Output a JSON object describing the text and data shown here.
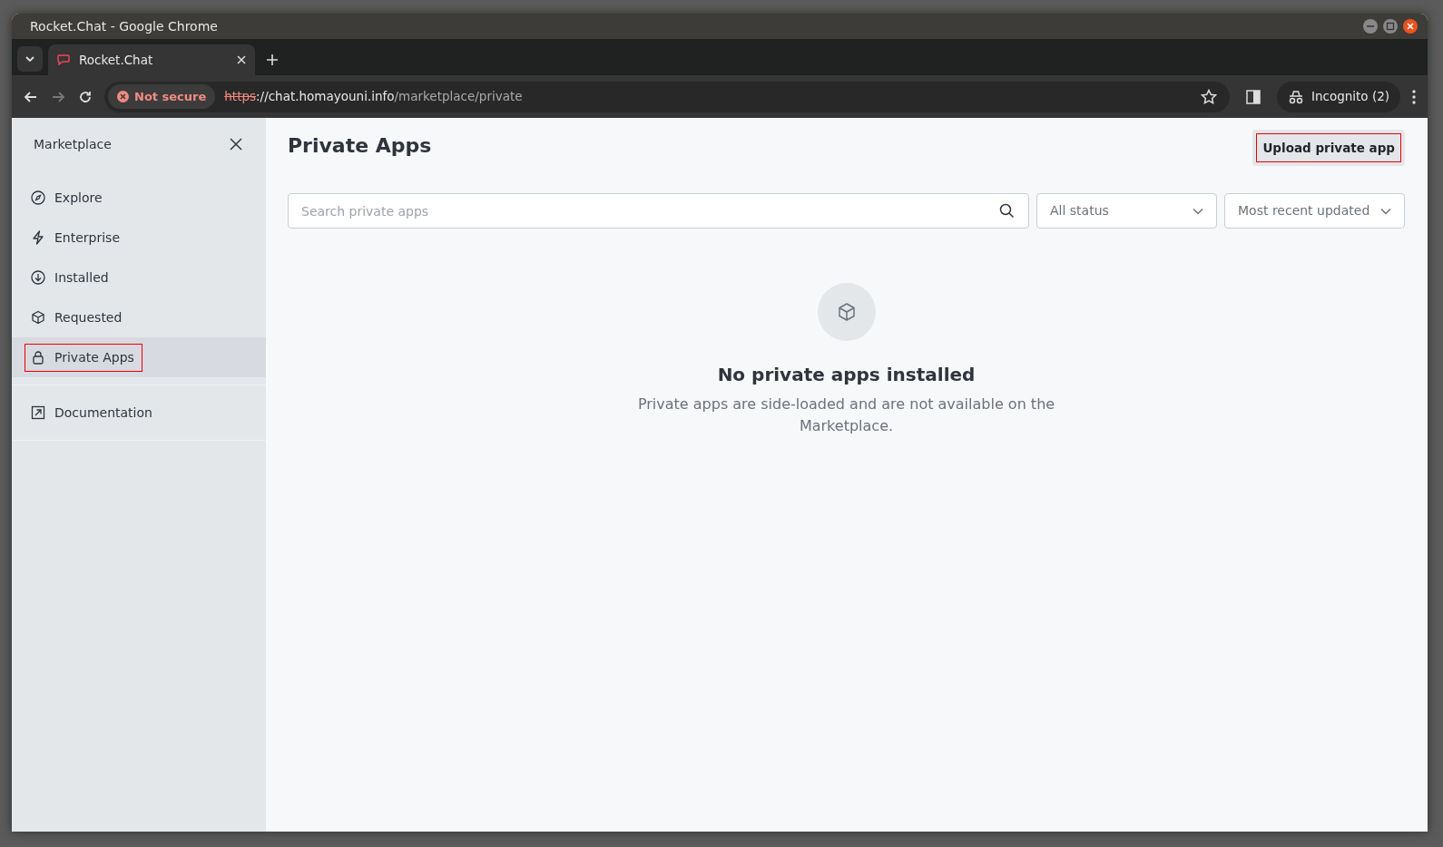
{
  "window": {
    "title": "Rocket.Chat - Google Chrome"
  },
  "browser": {
    "tabs": [
      {
        "title": "Rocket.Chat",
        "selected": true
      }
    ],
    "security_label": "Not secure",
    "url": {
      "scheme": "https",
      "host": "://chat.homayouni.info",
      "path": "/marketplace/private"
    },
    "profile": "Incognito (2)"
  },
  "sidebar": {
    "title": "Marketplace",
    "items": [
      {
        "label": "Explore",
        "selected": false,
        "highlighted": false
      },
      {
        "label": "Enterprise",
        "selected": false,
        "highlighted": false
      },
      {
        "label": "Installed",
        "selected": false,
        "highlighted": false
      },
      {
        "label": "Requested",
        "selected": false,
        "highlighted": false
      },
      {
        "label": "Private Apps",
        "selected": true,
        "highlighted": true
      }
    ],
    "links": [
      {
        "label": "Documentation"
      }
    ]
  },
  "page": {
    "title": "Private Apps",
    "upload_button": {
      "label": "Upload private app",
      "highlighted": true
    },
    "search": {
      "placeholder": "Search private apps"
    },
    "filters": [
      {
        "value": "All status"
      },
      {
        "value": "Most recent updated"
      }
    ],
    "empty_state": {
      "title": "No private apps installed",
      "description": "Private apps are side-loaded and are not available on the Marketplace."
    }
  }
}
